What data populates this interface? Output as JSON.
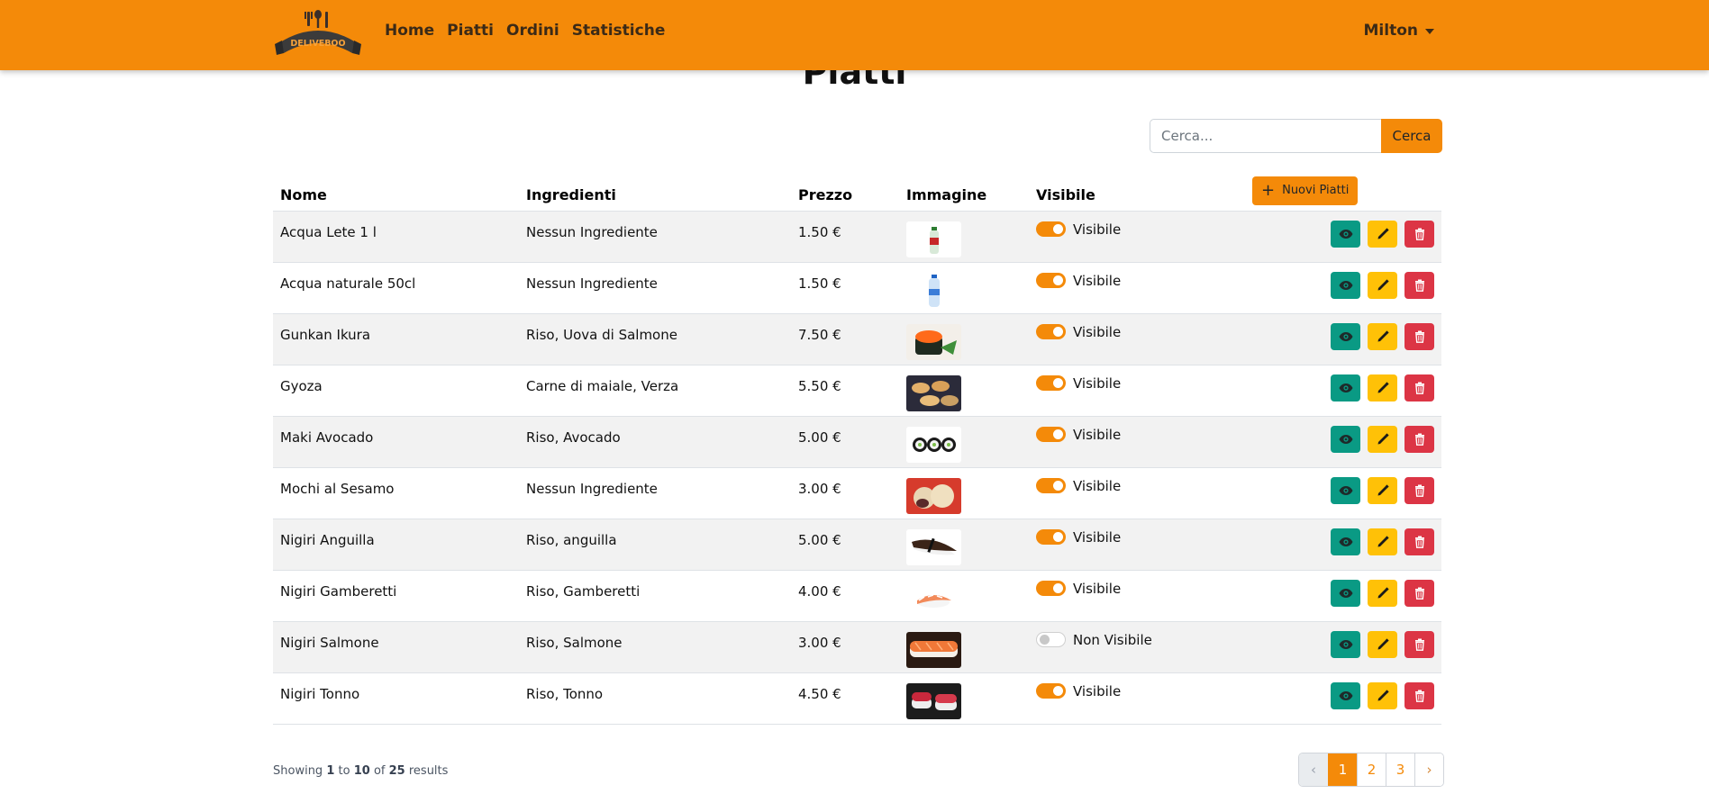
{
  "brand": {
    "name": "DELIVEBOO",
    "color": "#f48a09"
  },
  "nav": {
    "links": [
      {
        "label": "Home"
      },
      {
        "label": "Piatti"
      },
      {
        "label": "Ordini"
      },
      {
        "label": "Statistiche"
      }
    ],
    "user": "Milton"
  },
  "page": {
    "title": "Piatti"
  },
  "search": {
    "placeholder": "Cerca...",
    "button": "Cerca"
  },
  "table": {
    "headers": {
      "name": "Nome",
      "ingredients": "Ingredienti",
      "price": "Prezzo",
      "image": "Immagine",
      "visible": "Visibile"
    },
    "new_button": "Nuovi Piatti",
    "rows": [
      {
        "name": "Acqua Lete 1 l",
        "ingredients": "Nessun Ingrediente",
        "price": "1.50 €",
        "visible_label": "Visibile",
        "visible": true,
        "image": "water-bottle"
      },
      {
        "name": "Acqua naturale 50cl",
        "ingredients": "Nessun Ingrediente",
        "price": "1.50 €",
        "visible_label": "Visibile",
        "visible": true,
        "image": "water-bottle-small"
      },
      {
        "name": "Gunkan Ikura",
        "ingredients": "Riso, Uova di Salmone",
        "price": "7.50 €",
        "visible_label": "Visibile",
        "visible": true,
        "image": "gunkan"
      },
      {
        "name": "Gyoza",
        "ingredients": "Carne di maiale, Verza",
        "price": "5.50 €",
        "visible_label": "Visibile",
        "visible": true,
        "image": "gyoza"
      },
      {
        "name": "Maki Avocado",
        "ingredients": "Riso, Avocado",
        "price": "5.00 €",
        "visible_label": "Visibile",
        "visible": true,
        "image": "maki"
      },
      {
        "name": "Mochi al Sesamo",
        "ingredients": "Nessun Ingrediente",
        "price": "3.00 €",
        "visible_label": "Visibile",
        "visible": true,
        "image": "mochi"
      },
      {
        "name": "Nigiri Anguilla",
        "ingredients": "Riso, anguilla",
        "price": "5.00 €",
        "visible_label": "Visibile",
        "visible": true,
        "image": "nigiri-eel"
      },
      {
        "name": "Nigiri Gamberetti",
        "ingredients": "Riso, Gamberetti",
        "price": "4.00 €",
        "visible_label": "Visibile",
        "visible": true,
        "image": "nigiri-shrimp"
      },
      {
        "name": "Nigiri Salmone",
        "ingredients": "Riso, Salmone",
        "price": "3.00 €",
        "visible_label": "Non Visibile",
        "visible": false,
        "image": "nigiri-salmon"
      },
      {
        "name": "Nigiri Tonno",
        "ingredients": "Riso, Tonno",
        "price": "4.50 €",
        "visible_label": "Visibile",
        "visible": true,
        "image": "nigiri-tuna"
      }
    ]
  },
  "footer": {
    "showing_prefix": "Showing",
    "from": "1",
    "to_word": "to",
    "to": "10",
    "of_word": "of",
    "total": "25",
    "suffix": "results",
    "pages": [
      "‹",
      "1",
      "2",
      "3",
      "›"
    ]
  }
}
